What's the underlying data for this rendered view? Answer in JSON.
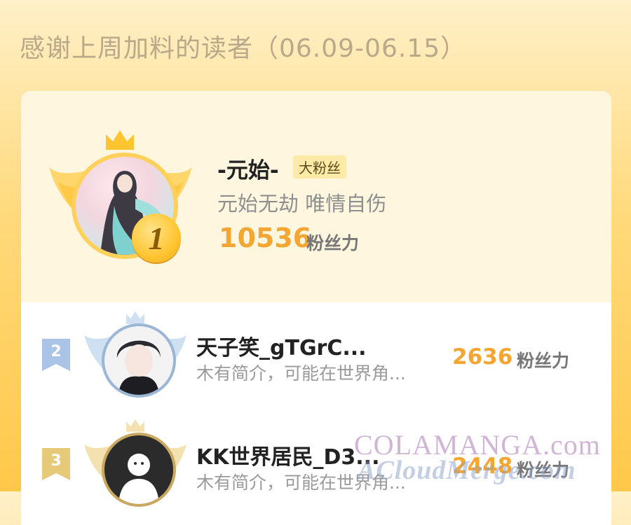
{
  "header": {
    "title": "感谢上周加料的读者（06.09-06.15）"
  },
  "first": {
    "rank": "1",
    "name": "-元始-",
    "badge": "大粉丝",
    "bio": "元始无劫 唯情自伤",
    "score": "10536",
    "unit": "粉丝力"
  },
  "rows": [
    {
      "rank": "2",
      "name": "天子笑_gTGrC...",
      "bio": "木有简介，可能在世界角...",
      "score": "2636",
      "unit": "粉丝力"
    },
    {
      "rank": "3",
      "name": "KK世界居民_D3...",
      "bio": "木有简介，可能在世界角...",
      "score": "2448",
      "unit": "粉丝力"
    }
  ],
  "watermark": {
    "line1": "COLAMANGA.com",
    "line2": "ACloudMerge.com"
  },
  "colors": {
    "score": "#f3a632",
    "gold": "#ffc531",
    "silver": "#a9c4e6",
    "bronze": "#e7c97a"
  }
}
